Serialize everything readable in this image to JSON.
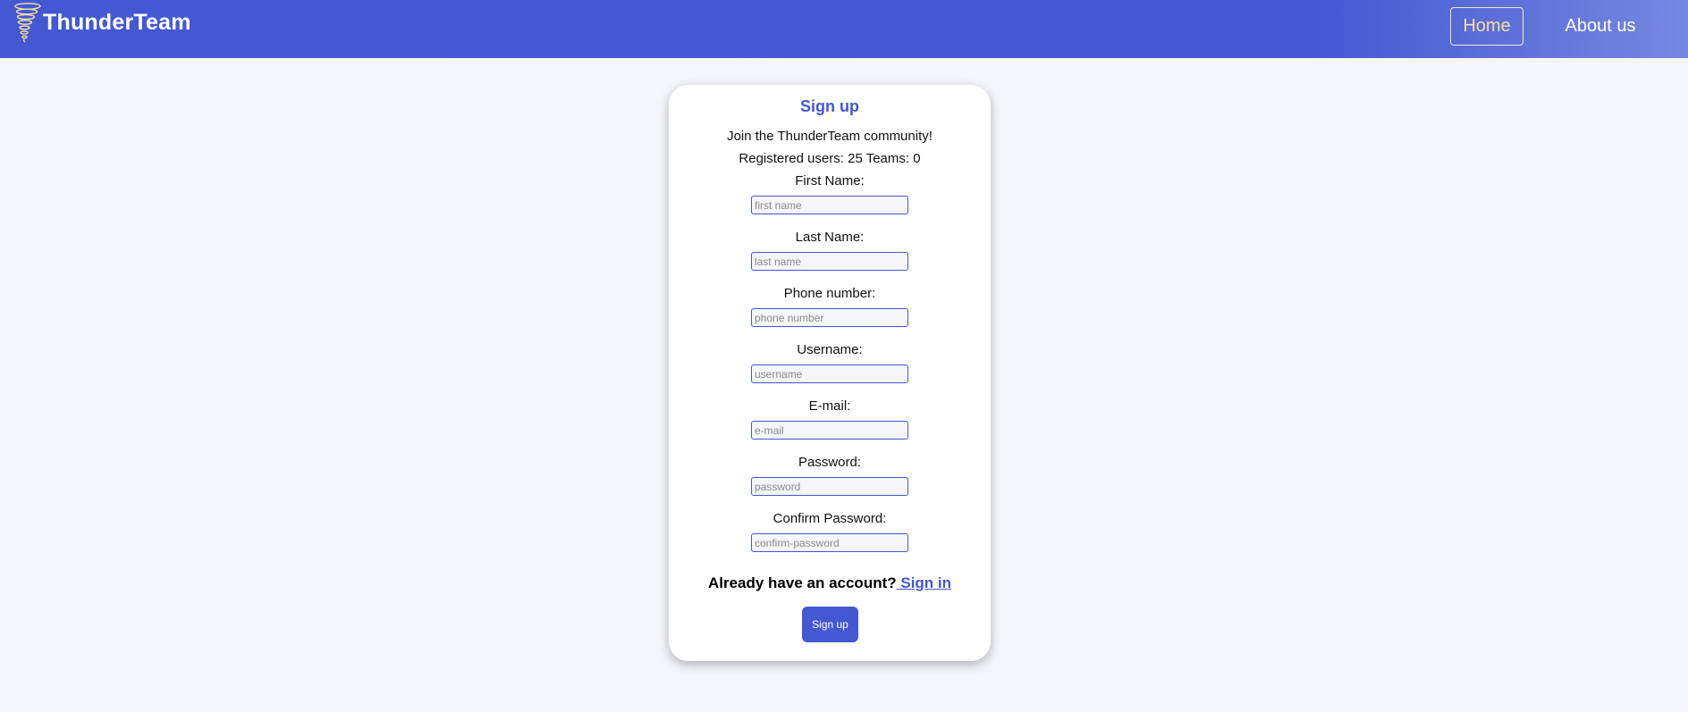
{
  "header": {
    "brand_name": "ThunderTeam",
    "nav": {
      "home_label": "Home",
      "about_label": "About us"
    }
  },
  "signup": {
    "title": "Sign up",
    "tagline": "Join the ThunderTeam community!",
    "stats": "Registered users: 25 Teams: 0",
    "fields": {
      "first_name": {
        "label": "First Name:",
        "placeholder": "first name"
      },
      "last_name": {
        "label": "Last Name:",
        "placeholder": "last name"
      },
      "phone": {
        "label": "Phone number:",
        "placeholder": "phone number"
      },
      "username": {
        "label": "Username:",
        "placeholder": "username"
      },
      "email": {
        "label": "E-mail:",
        "placeholder": "e-mail"
      },
      "password": {
        "label": "Password:",
        "placeholder": "password"
      },
      "confirm_password": {
        "label": "Confirm Password:",
        "placeholder": "confirm-password"
      }
    },
    "account_prompt": "Already have an account?",
    "signin_link": " Sign in",
    "submit_label": "Sign up"
  },
  "colors": {
    "brand_blue": "#4358d2",
    "home_accent": "#f6dfa0",
    "page_background": "#f5f6fa"
  },
  "icons": {
    "brand_logo": "tornado-icon"
  }
}
